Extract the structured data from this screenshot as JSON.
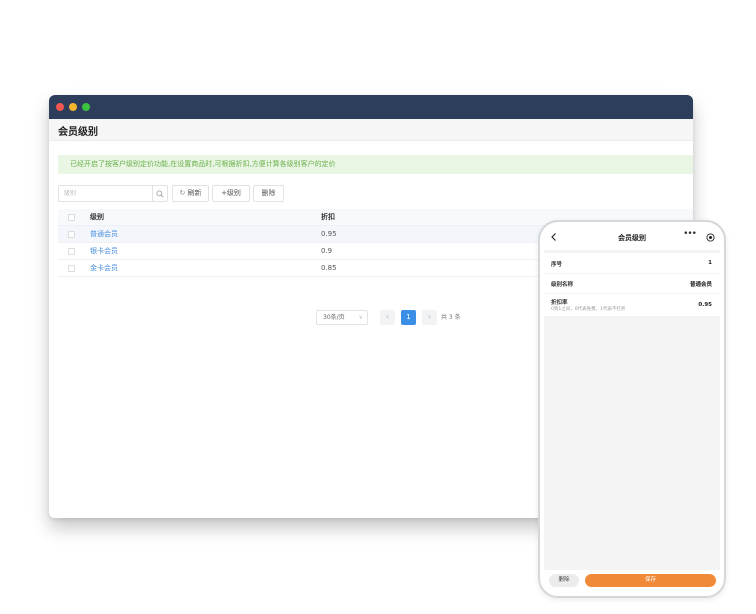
{
  "desktop": {
    "page_title": "会员级别",
    "notice": "已经开启了按客户级别定价功能,在设置商品时,可根据折扣,方便计算各级别客户的定价",
    "toolbar": {
      "search_placeholder": "级别",
      "refresh_label": "刷新",
      "add_label": "+级别",
      "delete_label": "删除"
    },
    "table": {
      "headers": {
        "name": "级别",
        "discount": "折扣"
      },
      "rows": [
        {
          "name": "普通会员",
          "discount": "0.95"
        },
        {
          "name": "银卡会员",
          "discount": "0.9"
        },
        {
          "name": "金卡会员",
          "discount": "0.85"
        }
      ]
    },
    "pagination": {
      "page_size": "30条/页",
      "current_page": "1",
      "total": "共 3 条"
    }
  },
  "mobile": {
    "nav_title": "会员级别",
    "fields": {
      "seq_label": "序号",
      "seq_value": "1",
      "name_label": "级别名称",
      "name_value": "普通会员",
      "discount_label": "折扣率",
      "discount_hint": "0到1之间，0代表免费，1代表不打折",
      "discount_value": "0.95"
    },
    "delete_label": "删除",
    "save_label": "保存"
  },
  "colors": {
    "titlebar": "#2d3e5c",
    "link": "#4a8fdc",
    "notice_text": "#6ab04c",
    "notice_bg": "#eaf6e4",
    "pager_active": "#3a8ee6",
    "save_button": "#f08a38"
  }
}
